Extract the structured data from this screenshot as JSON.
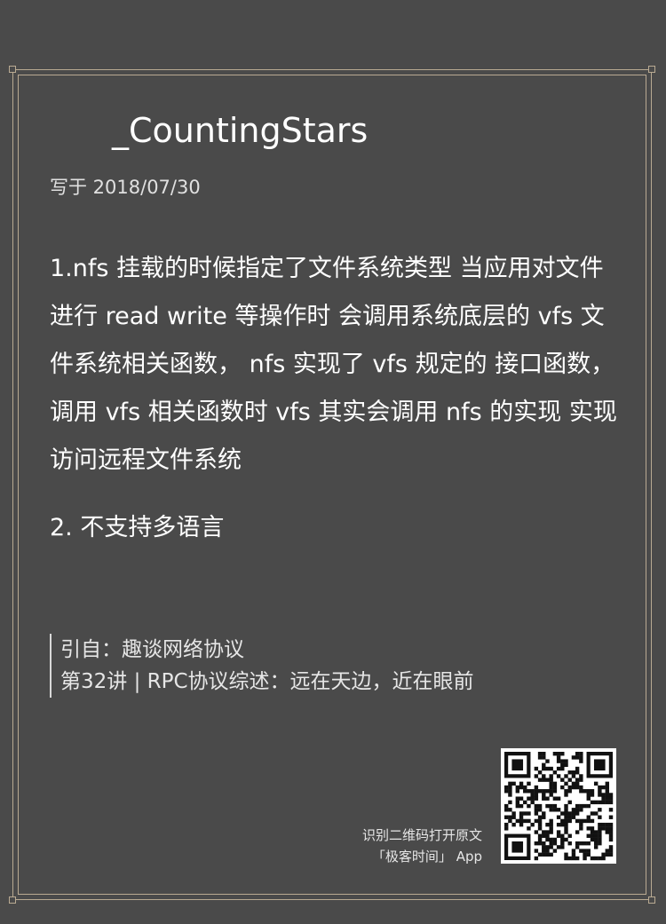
{
  "author": "_CountingStars",
  "date": "写于 2018/07/30",
  "comment": {
    "paragraph1": "1.nfs 挂载的时候指定了文件系统类型 当应用对文件进行 read write 等操作时 会调用系统底层的 vfs 文件系统相关函数， nfs 实现了 vfs 规定的 接口函数，调用 vfs 相关函数时 vfs 其实会调用 nfs 的实现 实现访问远程文件系统",
    "paragraph2": "2. 不支持多语言"
  },
  "quote": {
    "line1": "引自：趣谈网络协议",
    "line2": "第32讲 | RPC协议综述：远在天边，近在眼前"
  },
  "qr": {
    "hint_line1": "识别二维码打开原文",
    "hint_line2": "「极客时间」 App",
    "icon": "qr-code-icon"
  },
  "colors": {
    "background": "#4a4a4a",
    "frame": "#b9aa92",
    "text": "#ffffff"
  }
}
